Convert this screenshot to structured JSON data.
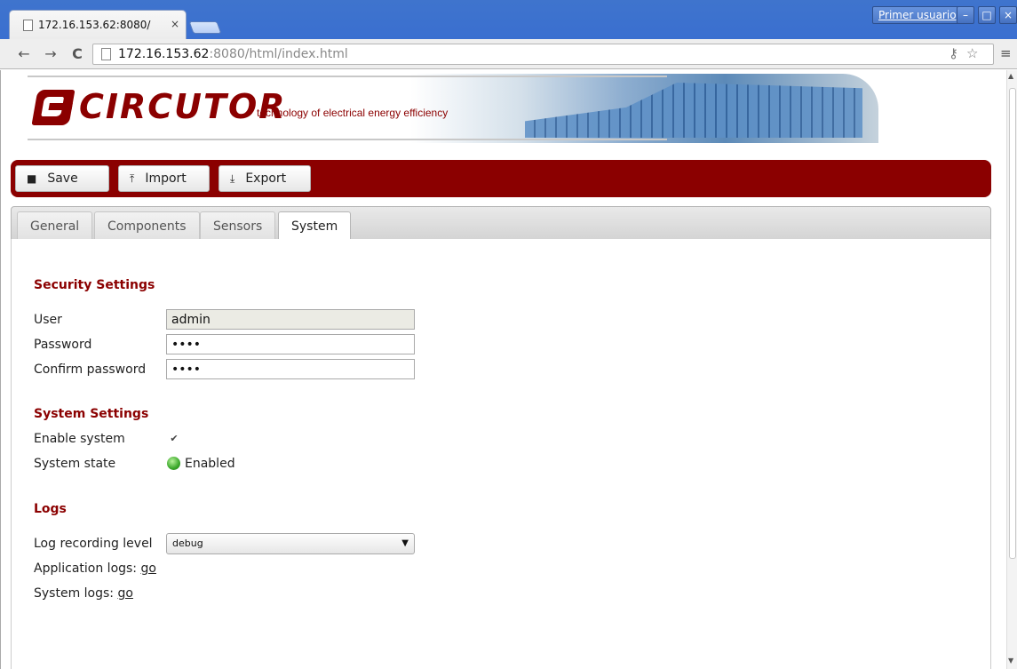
{
  "browser": {
    "tab_title": "172.16.153.62:8080/",
    "tab_close": "×",
    "profile_label": "Primer usuario",
    "url_host": "172.16.153.62",
    "url_rest": ":8080/html/index.html",
    "window_min": "–",
    "window_max": "□",
    "window_close": "×",
    "back_glyph": "←",
    "forward_glyph": "→",
    "reload_glyph": "C",
    "menu_glyph": "≡",
    "star_glyph": "☆",
    "key_glyph": "⚷"
  },
  "brand": {
    "name": "CIRCUTOR",
    "tagline": "technology of electrical energy efficiency"
  },
  "actions": {
    "save": "Save",
    "import": "Import",
    "export": "Export",
    "save_icon": "■",
    "import_icon": "⤒",
    "export_icon": "⤓"
  },
  "tabs": [
    {
      "label": "General"
    },
    {
      "label": "Components"
    },
    {
      "label": "Sensors"
    },
    {
      "label": "System"
    }
  ],
  "security": {
    "title": "Security Settings",
    "user_label": "User",
    "user_value": "admin",
    "password_label": "Password",
    "password_value": "••••",
    "confirm_label": "Confirm password",
    "confirm_value": "••••"
  },
  "system": {
    "title": "System Settings",
    "enable_label": "Enable system",
    "enable_checked": "✔",
    "state_label": "System state",
    "state_value": "Enabled",
    "state_color": "#3aa72a"
  },
  "logs": {
    "title": "Logs",
    "level_label": "Log recording level",
    "level_value": "debug",
    "level_arrow": "▼",
    "app_logs_label": "Application logs:",
    "system_logs_label": "System logs:",
    "go_link": "go"
  },
  "colors": {
    "brand_red": "#8b0000",
    "chrome_blue": "#3a6fd0"
  }
}
